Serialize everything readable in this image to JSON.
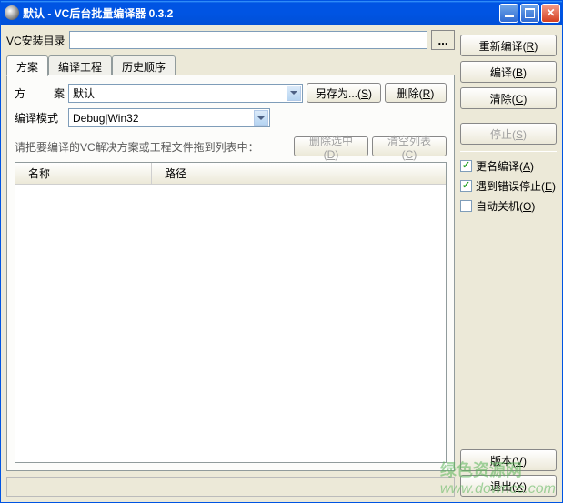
{
  "window": {
    "title": "默认 - VC后台批量编译器 0.3.2"
  },
  "top": {
    "install_dir_label": "VC安装目录",
    "install_dir_value": "",
    "browse_label": "..."
  },
  "tabs": {
    "scheme": "方案",
    "compile_project": "编译工程",
    "history": "历史顺序"
  },
  "scheme_tab": {
    "scheme_label_a": "方",
    "scheme_label_b": "案",
    "scheme_value": "默认",
    "compile_mode_label": "编译模式",
    "compile_mode_value": "Debug|Win32",
    "save_as_btn": "另存为...(S)",
    "delete_btn": "删除(R)",
    "hint": "请把要编译的VC解决方案或工程文件拖到列表中：",
    "remove_sel_btn": "删除选中(D)",
    "clear_list_btn": "清空列表(C)",
    "col_name": "名称",
    "col_path": "路径"
  },
  "right": {
    "recompile": "重新编译(R)",
    "compile": "编译(B)",
    "clear": "清除(C)",
    "stop": "停止(S)",
    "rename_compile": "更名编译(A)",
    "stop_on_error": "遇到错误停止(E)",
    "auto_shutdown": "自动关机(O)",
    "version": "版本(V)",
    "exit": "退出(X)"
  },
  "checks": {
    "rename_compile": true,
    "stop_on_error": true,
    "auto_shutdown": false
  },
  "watermark": {
    "cn": "绿色资源网",
    "en": "www.downcc.com"
  }
}
